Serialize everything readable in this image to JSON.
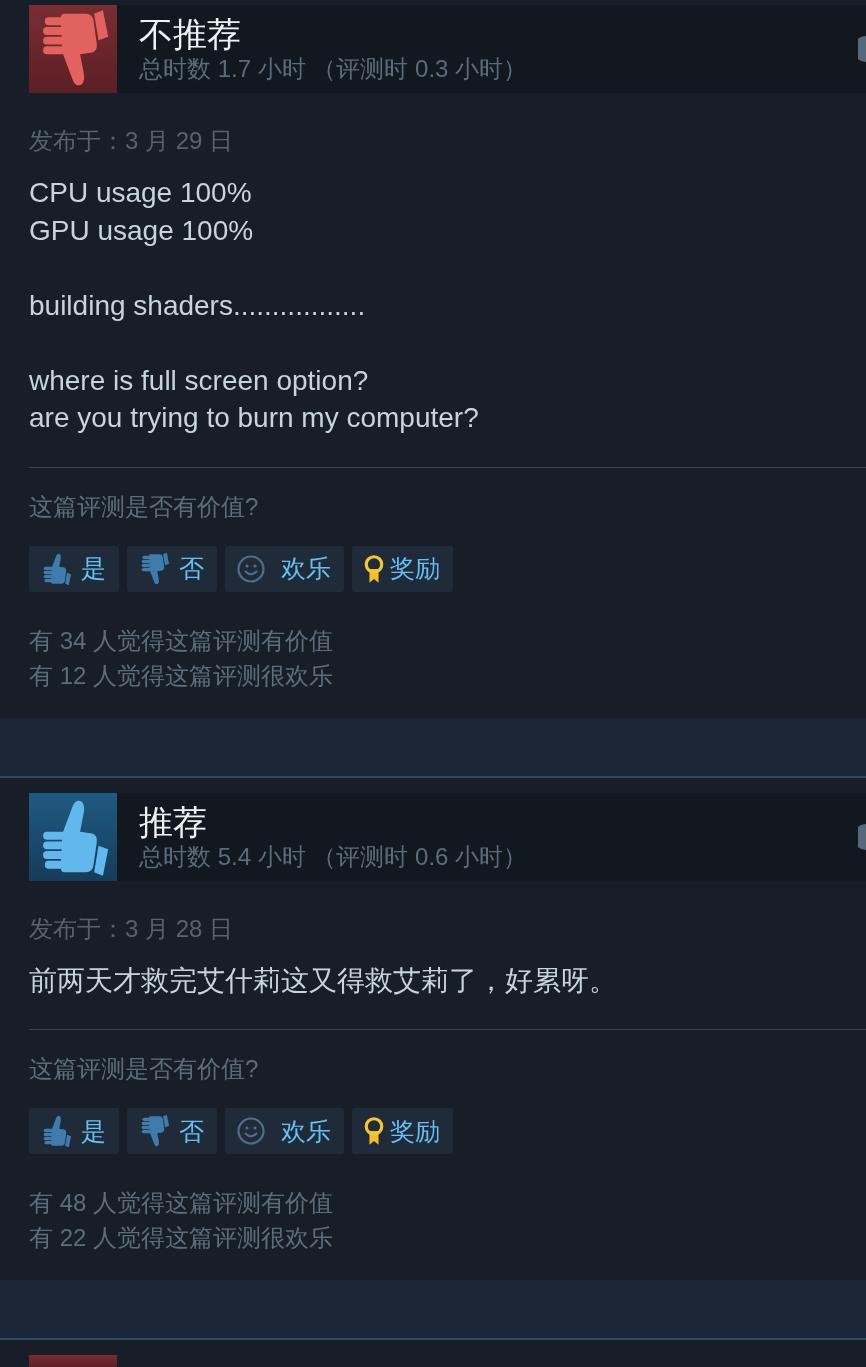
{
  "reviews": [
    {
      "recommended": false,
      "title": "不推荐",
      "hours": "总时数 1.7 小时 （评测时 0.3 小时）",
      "date": "发布于：3 月 29 日",
      "body": [
        "CPU usage 100%\nGPU usage 100%",
        "building shaders.................",
        "where is full screen option?\nare you trying to burn my computer?"
      ],
      "question": "这篇评测是否有价值?",
      "buttons": [
        {
          "kind": "yes",
          "label": "是"
        },
        {
          "kind": "no",
          "label": "否"
        },
        {
          "kind": "funny",
          "label": "欢乐"
        },
        {
          "kind": "award",
          "label": "奖励"
        }
      ],
      "stats": [
        "有 34 人觉得这篇评测有价值",
        "有 12 人觉得这篇评测很欢乐"
      ]
    },
    {
      "recommended": true,
      "title": "推荐",
      "hours": "总时数 5.4 小时 （评测时 0.6 小时）",
      "date": "发布于：3 月 28 日",
      "body": [
        "前两天才救完艾什莉这又得救艾莉了，好累呀。"
      ],
      "question": "这篇评测是否有价值?",
      "buttons": [
        {
          "kind": "yes",
          "label": "是"
        },
        {
          "kind": "no",
          "label": "否"
        },
        {
          "kind": "funny",
          "label": "欢乐"
        },
        {
          "kind": "award",
          "label": "奖励"
        }
      ],
      "stats": [
        "有 48 人觉得这篇评测有价值",
        "有 22 人觉得这篇评测很欢乐"
      ]
    },
    {
      "recommended": false
    }
  ]
}
